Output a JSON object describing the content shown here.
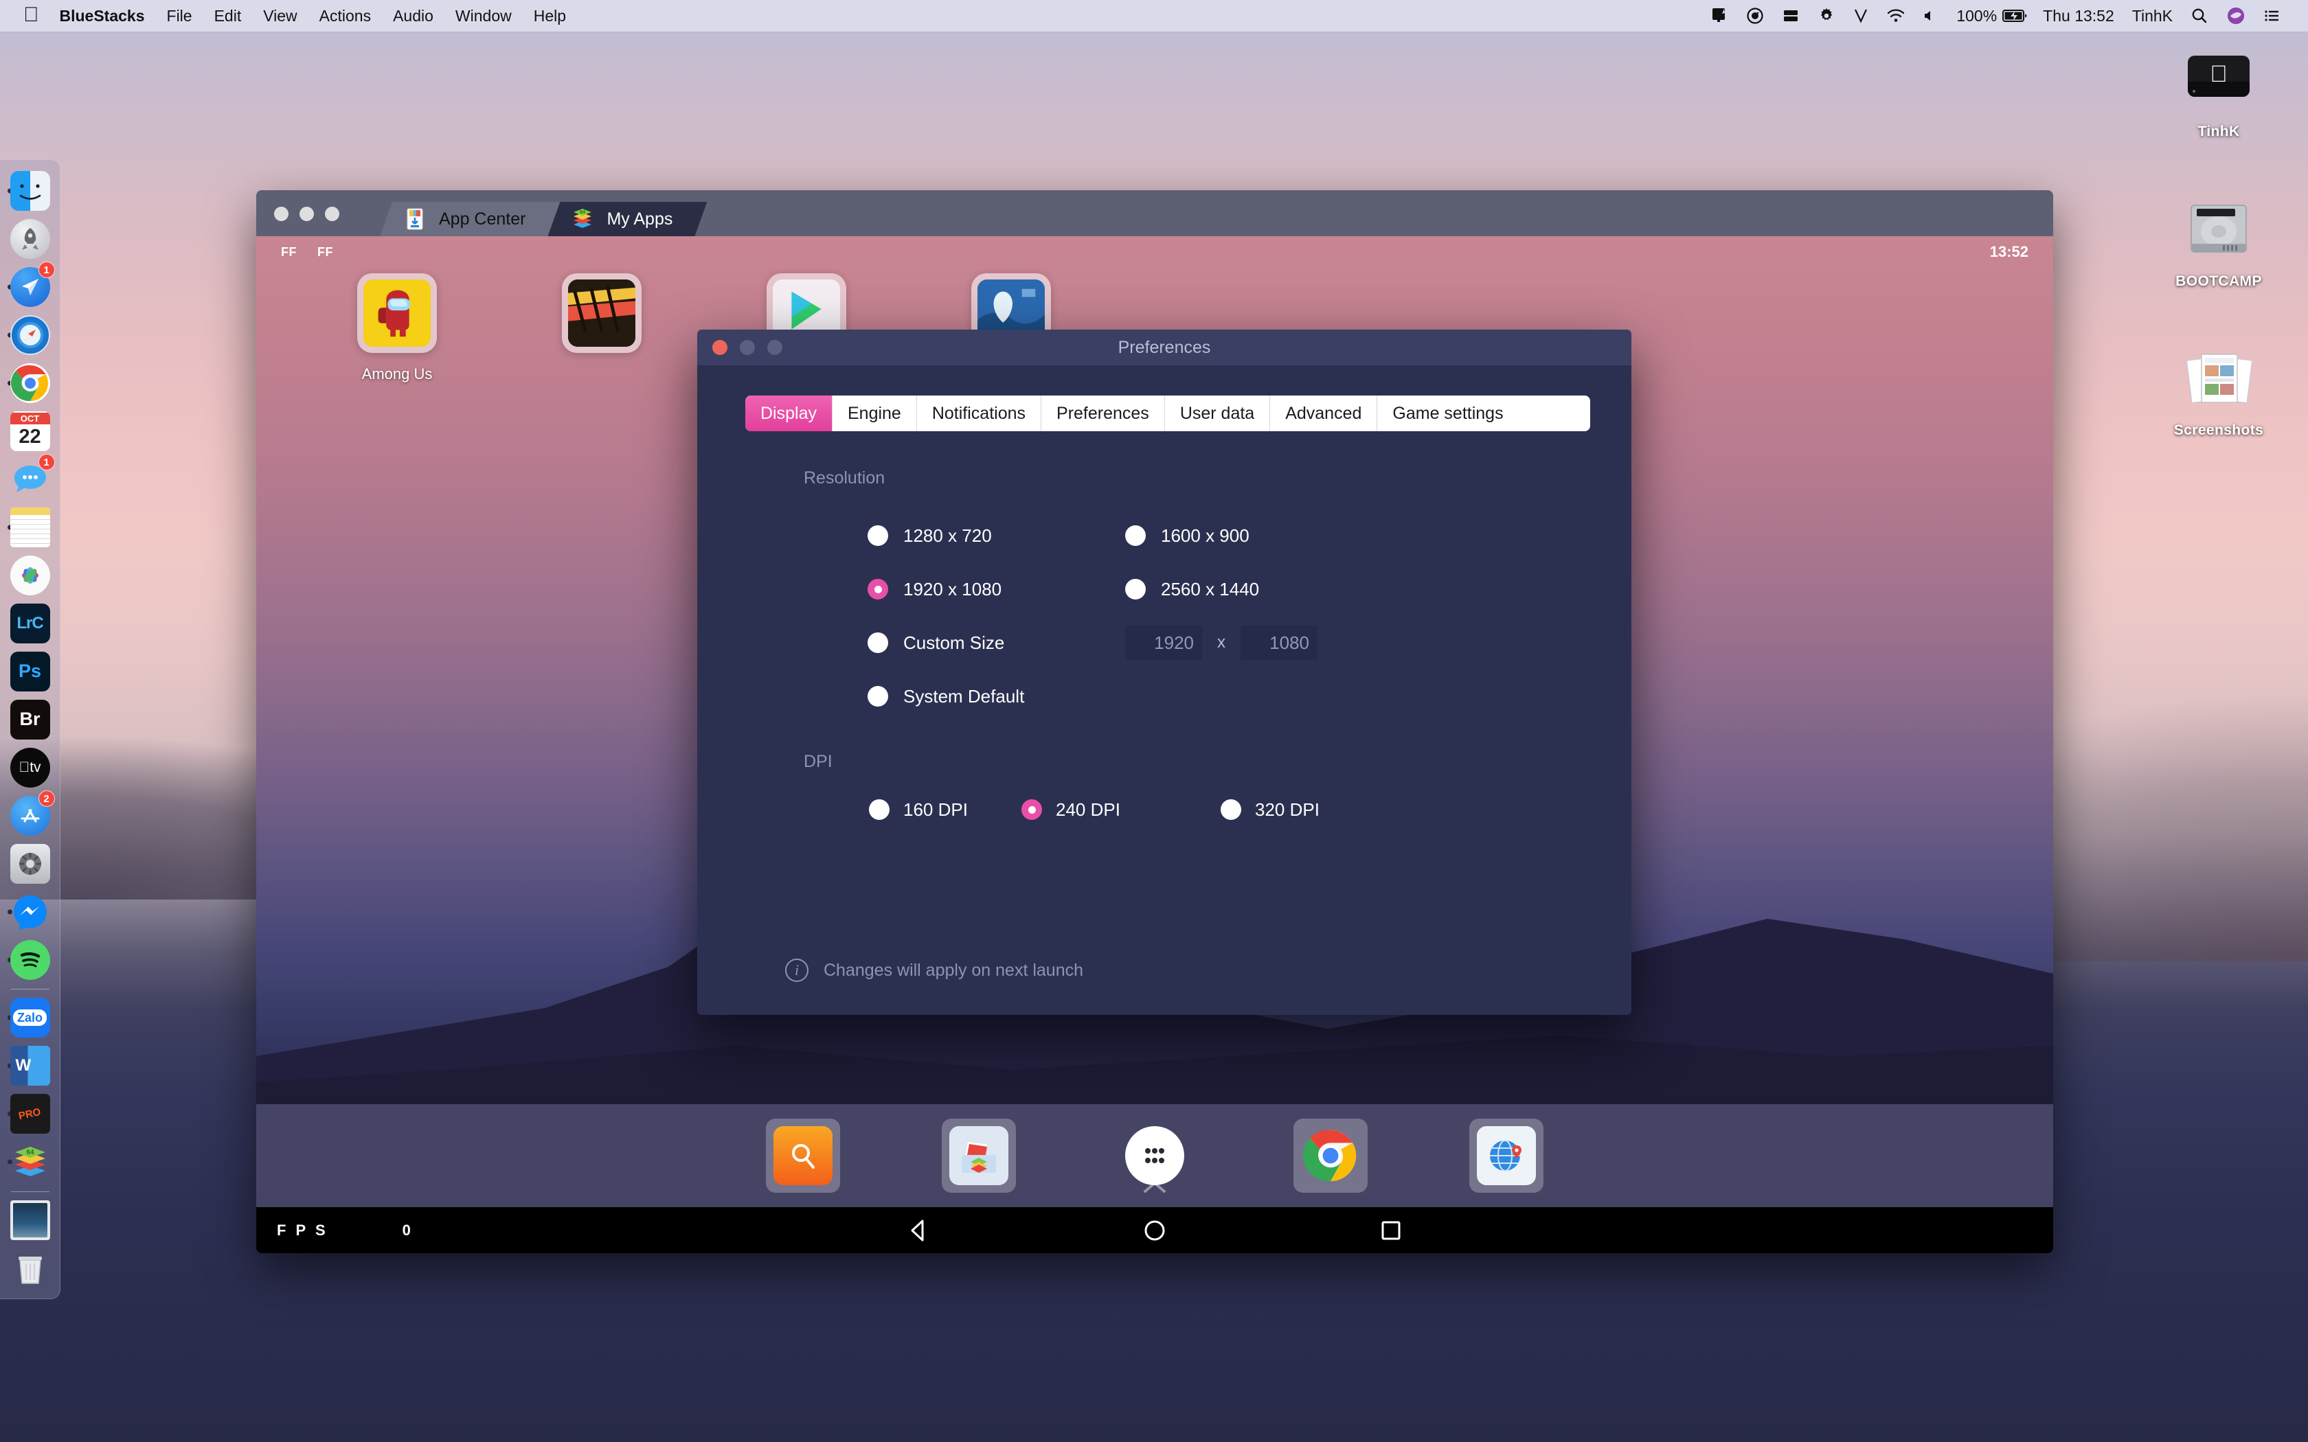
{
  "menubar": {
    "apple_icon": "apple-logo",
    "items": [
      "BlueStacks",
      "File",
      "Edit",
      "View",
      "Actions",
      "Audio",
      "Window",
      "Help"
    ],
    "status_icons": [
      "display-icon",
      "time-machine-icon",
      "drive-icon",
      "gear-icon",
      "vpn-icon",
      "wifi-icon",
      "volume-icon"
    ],
    "battery_percent": "100%",
    "battery_icon": "battery-charging-icon",
    "clock": "Thu 13:52",
    "user": "TinhK",
    "search_icon": "search-icon",
    "siri_icon": "siri-icon",
    "control_center_icon": "notification-center-icon"
  },
  "dock": {
    "items": [
      {
        "name": "finder",
        "label": "Finder",
        "running": true,
        "badge": null
      },
      {
        "name": "launchpad",
        "label": "Launchpad",
        "running": false,
        "badge": null
      },
      {
        "name": "spark-mail",
        "label": "Spark",
        "running": true,
        "badge": "1"
      },
      {
        "name": "safari",
        "label": "Safari",
        "running": true,
        "badge": null
      },
      {
        "name": "chrome",
        "label": "Google Chrome",
        "running": true,
        "badge": null
      },
      {
        "name": "calendar",
        "label": "Calendar",
        "running": false,
        "badge": null,
        "month": "OCT",
        "day": "22"
      },
      {
        "name": "messages",
        "label": "Messages",
        "running": false,
        "badge": "1"
      },
      {
        "name": "notes",
        "label": "Notes",
        "running": true,
        "badge": null
      },
      {
        "name": "photos",
        "label": "Photos",
        "running": false,
        "badge": null
      },
      {
        "name": "lightroom-classic",
        "label": "LrC",
        "running": false,
        "badge": null
      },
      {
        "name": "photoshop",
        "label": "Ps",
        "running": false,
        "badge": null
      },
      {
        "name": "bridge",
        "label": "Br",
        "running": false,
        "badge": null
      },
      {
        "name": "apple-tv",
        "label": "tv",
        "running": false,
        "badge": null
      },
      {
        "name": "app-store",
        "label": "App Store",
        "running": false,
        "badge": "2"
      },
      {
        "name": "system-preferences",
        "label": "System Preferences",
        "running": false,
        "badge": null
      },
      {
        "name": "messenger",
        "label": "Messenger",
        "running": true,
        "badge": null
      },
      {
        "name": "spotify",
        "label": "Spotify",
        "running": true,
        "badge": null
      },
      {
        "name": "zalo",
        "label": "Zalo",
        "running": true,
        "badge": null
      },
      {
        "name": "word",
        "label": "W",
        "running": true,
        "badge": null
      },
      {
        "name": "jpegmini-pro",
        "label": "JPEGmini PRO",
        "running": true,
        "badge": null
      },
      {
        "name": "bluestacks",
        "label": "BlueStacks",
        "running": true,
        "badge": null
      },
      {
        "name": "downloads-stack",
        "label": "Downloads",
        "running": false,
        "badge": null
      },
      {
        "name": "trash",
        "label": "Trash",
        "running": false,
        "badge": null
      }
    ]
  },
  "desktop_icons": [
    {
      "name": "tinhk-drive",
      "label": "TinhK",
      "icon": "external-drive-icon"
    },
    {
      "name": "bootcamp-drive",
      "label": "BOOTCAMP",
      "icon": "hard-drive-icon"
    },
    {
      "name": "screenshots-folder",
      "label": "Screenshots",
      "icon": "image-stack-icon"
    }
  ],
  "bluestacks": {
    "window_controls": [
      "close",
      "minimize",
      "maximize"
    ],
    "tabs": [
      {
        "label": "App Center",
        "icon": "app-center-icon",
        "active": false
      },
      {
        "label": "My Apps",
        "icon": "bluestacks-logo-icon",
        "active": true
      }
    ],
    "status_left": [
      "FF",
      "FF"
    ],
    "clock": "13:52",
    "apps": [
      {
        "name": "among-us",
        "label": "Among Us"
      },
      {
        "name": "app-2",
        "label": ""
      },
      {
        "name": "play-store",
        "label": ""
      },
      {
        "name": "app-4",
        "label": ""
      }
    ],
    "expand_chevron": "chevron-up-icon",
    "dock_items": [
      {
        "name": "search",
        "icon": "search-icon"
      },
      {
        "name": "media-manager",
        "icon": "media-manager-icon"
      },
      {
        "name": "app-drawer",
        "icon": "app-drawer-icon"
      },
      {
        "name": "chrome",
        "icon": "chrome-icon"
      },
      {
        "name": "browser",
        "icon": "globe-icon"
      }
    ],
    "fps_label": "F P S",
    "fps_value": "0",
    "nav_buttons": [
      {
        "name": "back",
        "icon": "triangle-back-icon"
      },
      {
        "name": "home",
        "icon": "circle-home-icon"
      },
      {
        "name": "recents",
        "icon": "square-recents-icon"
      }
    ]
  },
  "preferences": {
    "title": "Preferences",
    "window_controls": [
      "close",
      "minimize",
      "maximize"
    ],
    "tabs": [
      {
        "label": "Display",
        "active": true
      },
      {
        "label": "Engine",
        "active": false
      },
      {
        "label": "Notifications",
        "active": false
      },
      {
        "label": "Preferences",
        "active": false
      },
      {
        "label": "User data",
        "active": false
      },
      {
        "label": "Advanced",
        "active": false
      },
      {
        "label": "Game settings",
        "active": false
      }
    ],
    "resolution": {
      "section_label": "Resolution",
      "options": [
        {
          "label": "1280 x 720",
          "selected": false
        },
        {
          "label": "1600 x 900",
          "selected": false
        },
        {
          "label": "1920 x 1080",
          "selected": true
        },
        {
          "label": "2560 x 1440",
          "selected": false
        },
        {
          "label": "Custom Size",
          "selected": false
        },
        {
          "label": "System Default",
          "selected": false
        }
      ],
      "custom_width": "1920",
      "custom_height": "1080",
      "custom_separator": "x"
    },
    "dpi": {
      "section_label": "DPI",
      "options": [
        {
          "label": "160 DPI",
          "selected": false
        },
        {
          "label": "240 DPI",
          "selected": true
        },
        {
          "label": "320 DPI",
          "selected": false
        }
      ]
    },
    "note": {
      "icon": "info-icon",
      "text": "Changes will apply on next launch"
    }
  },
  "colors": {
    "accent_pink": "#e94fa8",
    "dialog_bg": "#2c3050",
    "dialog_titlebar": "#3a3f63",
    "close_red": "#f0655a",
    "muted_text": "#8d93b3"
  }
}
